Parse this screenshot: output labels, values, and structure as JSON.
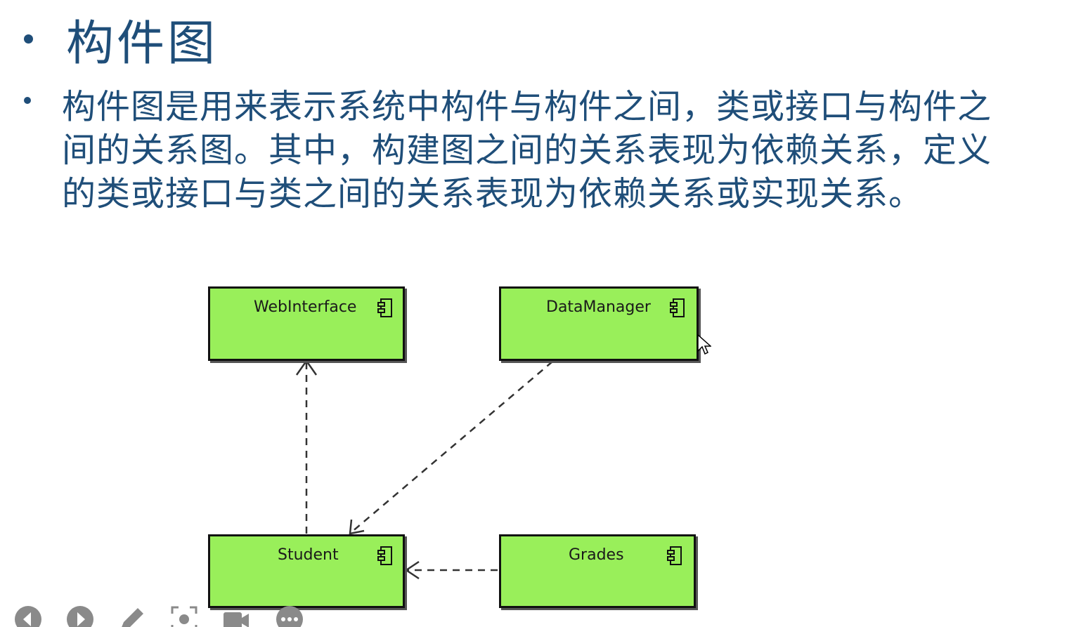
{
  "slide": {
    "title": "构件图",
    "body_lines": [
      "构件图是用来表示系统中构件与构件之间，类或接口与构件之",
      "间的关系图。其中，构建图之间的关系表现为依赖关系，定义",
      "的类或接口与类之间的关系表现为依赖关系或实现关系。"
    ]
  },
  "diagram": {
    "components": [
      {
        "name": "WebInterface"
      },
      {
        "name": "DataManager"
      },
      {
        "name": "Student"
      },
      {
        "name": "Grades"
      }
    ],
    "dependencies": [
      {
        "from": "Student",
        "to": "WebInterface"
      },
      {
        "from": "DataManager",
        "to": "Student"
      },
      {
        "from": "Grades",
        "to": "Student"
      }
    ],
    "component_fill": "#99ef5a",
    "border_color": "#111111"
  },
  "toolbar": {
    "icons": [
      "prev-icon",
      "next-icon",
      "pen-icon",
      "screenshot-icon",
      "video-icon",
      "more-icon"
    ]
  },
  "colors": {
    "text": "#1f4e79",
    "toolbar_icon": "#888888"
  }
}
